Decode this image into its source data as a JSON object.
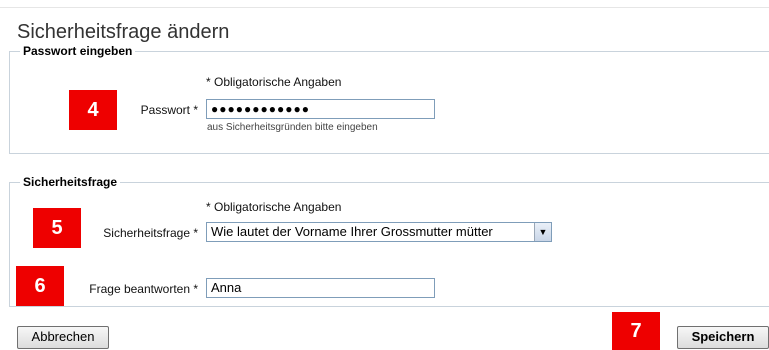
{
  "page": {
    "title": "Sicherheitsfrage ändern"
  },
  "password_section": {
    "legend": "Passwort eingeben",
    "required_note": "* Obligatorische Angaben",
    "password_label": "Passwort *",
    "password_value": "●●●●●●●●●●●●",
    "password_hint": "aus Sicherheitsgründen bitte eingeben"
  },
  "security_section": {
    "legend": "Sicherheitsfrage",
    "required_note": "* Obligatorische Angaben",
    "question_label": "Sicherheitsfrage *",
    "question_value": "Wie lautet der Vorname Ihrer Grossmutter mütter",
    "answer_label": "Frage beantworten *",
    "answer_value": "Anna"
  },
  "buttons": {
    "cancel": "Abbrechen",
    "save": "Speichern"
  },
  "badges": {
    "b4": "4",
    "b5": "5",
    "b6": "6",
    "b7": "7"
  },
  "icons": {
    "select_arrow": "chevron-down-icon"
  },
  "colors": {
    "badge": "#ee0000",
    "fieldset_border": "#c9d3dc",
    "input_border": "#7f9db9"
  }
}
